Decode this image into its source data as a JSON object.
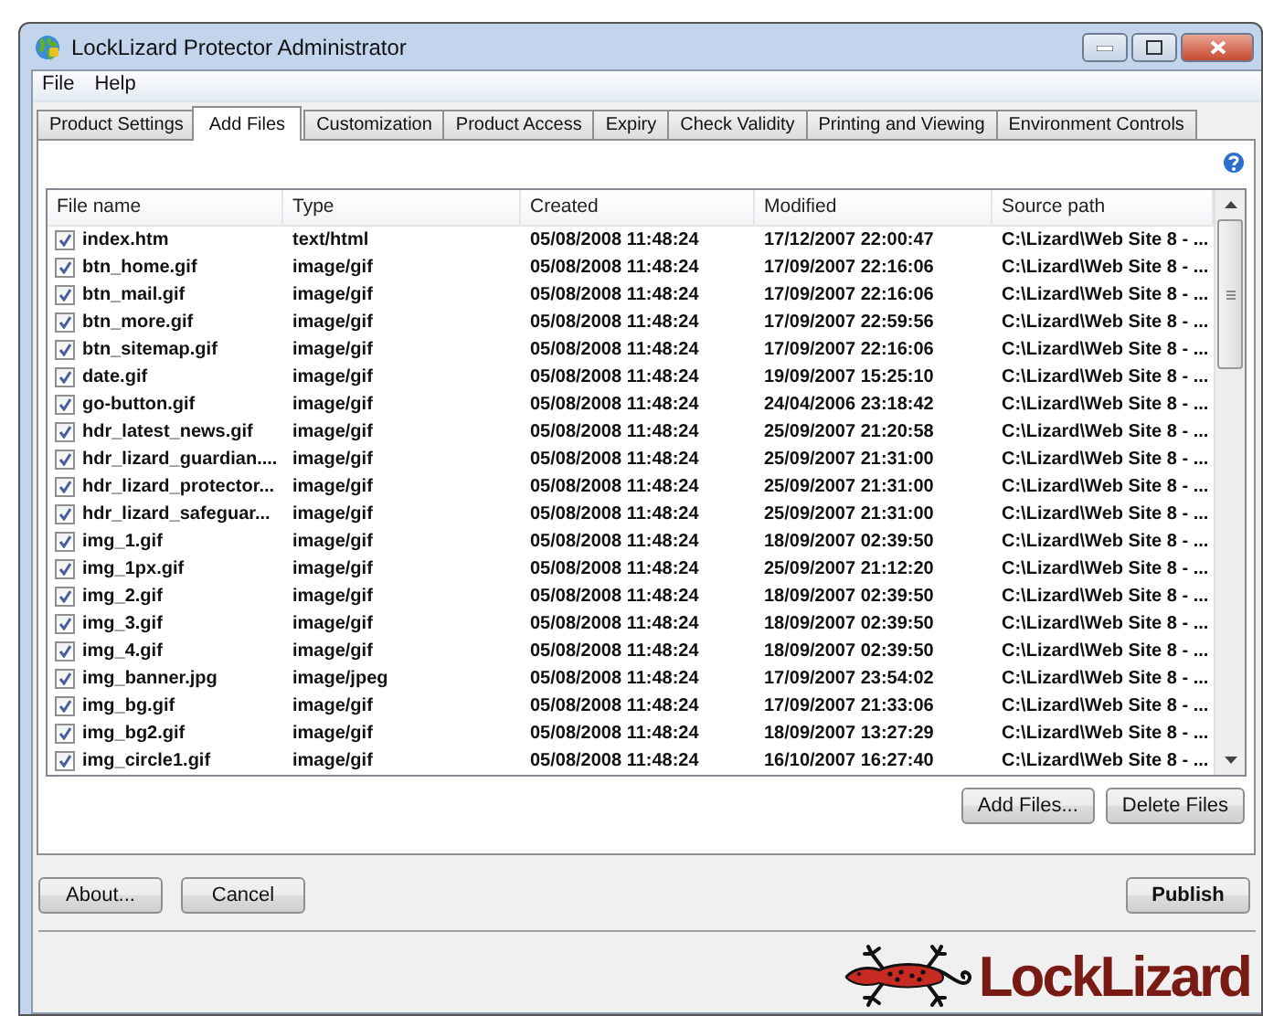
{
  "window": {
    "title": "LockLizard Protector Administrator"
  },
  "menu": [
    "File",
    "Help"
  ],
  "tabs": [
    {
      "label": "Product Settings",
      "selected": false
    },
    {
      "label": "Add Files",
      "selected": true
    },
    {
      "label": "Customization",
      "selected": false
    },
    {
      "label": "Product Access",
      "selected": false
    },
    {
      "label": "Expiry",
      "selected": false
    },
    {
      "label": "Check Validity",
      "selected": false
    },
    {
      "label": "Printing and Viewing",
      "selected": false
    },
    {
      "label": "Environment Controls",
      "selected": false
    }
  ],
  "table": {
    "columns": [
      "File name",
      "Type",
      "Created",
      "Modified",
      "Source path"
    ],
    "rows": [
      {
        "checked": true,
        "cells": [
          "index.htm",
          "text/html",
          "05/08/2008 11:48:24",
          "17/12/2007 22:00:47",
          "C:\\Lizard\\Web Site 8 - ..."
        ]
      },
      {
        "checked": true,
        "cells": [
          "btn_home.gif",
          "image/gif",
          "05/08/2008 11:48:24",
          "17/09/2007 22:16:06",
          "C:\\Lizard\\Web Site 8 - ..."
        ]
      },
      {
        "checked": true,
        "cells": [
          "btn_mail.gif",
          "image/gif",
          "05/08/2008 11:48:24",
          "17/09/2007 22:16:06",
          "C:\\Lizard\\Web Site 8 - ..."
        ]
      },
      {
        "checked": true,
        "cells": [
          "btn_more.gif",
          "image/gif",
          "05/08/2008 11:48:24",
          "17/09/2007 22:59:56",
          "C:\\Lizard\\Web Site 8 - ..."
        ]
      },
      {
        "checked": true,
        "cells": [
          "btn_sitemap.gif",
          "image/gif",
          "05/08/2008 11:48:24",
          "17/09/2007 22:16:06",
          "C:\\Lizard\\Web Site 8 - ..."
        ]
      },
      {
        "checked": true,
        "cells": [
          "date.gif",
          "image/gif",
          "05/08/2008 11:48:24",
          "19/09/2007 15:25:10",
          "C:\\Lizard\\Web Site 8 - ..."
        ]
      },
      {
        "checked": true,
        "cells": [
          "go-button.gif",
          "image/gif",
          "05/08/2008 11:48:24",
          "24/04/2006 23:18:42",
          "C:\\Lizard\\Web Site 8 - ..."
        ]
      },
      {
        "checked": true,
        "cells": [
          "hdr_latest_news.gif",
          "image/gif",
          "05/08/2008 11:48:24",
          "25/09/2007 21:20:58",
          "C:\\Lizard\\Web Site 8 - ..."
        ]
      },
      {
        "checked": true,
        "cells": [
          "hdr_lizard_guardian....",
          "image/gif",
          "05/08/2008 11:48:24",
          "25/09/2007 21:31:00",
          "C:\\Lizard\\Web Site 8 - ..."
        ]
      },
      {
        "checked": true,
        "cells": [
          "hdr_lizard_protector...",
          "image/gif",
          "05/08/2008 11:48:24",
          "25/09/2007 21:31:00",
          "C:\\Lizard\\Web Site 8 - ..."
        ]
      },
      {
        "checked": true,
        "cells": [
          "hdr_lizard_safeguar...",
          "image/gif",
          "05/08/2008 11:48:24",
          "25/09/2007 21:31:00",
          "C:\\Lizard\\Web Site 8 - ..."
        ]
      },
      {
        "checked": true,
        "cells": [
          "img_1.gif",
          "image/gif",
          "05/08/2008 11:48:24",
          "18/09/2007 02:39:50",
          "C:\\Lizard\\Web Site 8 - ..."
        ]
      },
      {
        "checked": true,
        "cells": [
          "img_1px.gif",
          "image/gif",
          "05/08/2008 11:48:24",
          "25/09/2007 21:12:20",
          "C:\\Lizard\\Web Site 8 - ..."
        ]
      },
      {
        "checked": true,
        "cells": [
          "img_2.gif",
          "image/gif",
          "05/08/2008 11:48:24",
          "18/09/2007 02:39:50",
          "C:\\Lizard\\Web Site 8 - ..."
        ]
      },
      {
        "checked": true,
        "cells": [
          "img_3.gif",
          "image/gif",
          "05/08/2008 11:48:24",
          "18/09/2007 02:39:50",
          "C:\\Lizard\\Web Site 8 - ..."
        ]
      },
      {
        "checked": true,
        "cells": [
          "img_4.gif",
          "image/gif",
          "05/08/2008 11:48:24",
          "18/09/2007 02:39:50",
          "C:\\Lizard\\Web Site 8 - ..."
        ]
      },
      {
        "checked": true,
        "cells": [
          "img_banner.jpg",
          "image/jpeg",
          "05/08/2008 11:48:24",
          "17/09/2007 23:54:02",
          "C:\\Lizard\\Web Site 8 - ..."
        ]
      },
      {
        "checked": true,
        "cells": [
          "img_bg.gif",
          "image/gif",
          "05/08/2008 11:48:24",
          "17/09/2007 21:33:06",
          "C:\\Lizard\\Web Site 8 - ..."
        ]
      },
      {
        "checked": true,
        "cells": [
          "img_bg2.gif",
          "image/gif",
          "05/08/2008 11:48:24",
          "18/09/2007 13:27:29",
          "C:\\Lizard\\Web Site 8 - ..."
        ]
      },
      {
        "checked": true,
        "cells": [
          "img_circle1.gif",
          "image/gif",
          "05/08/2008 11:48:24",
          "16/10/2007 16:27:40",
          "C:\\Lizard\\Web Site 8 - ..."
        ]
      }
    ]
  },
  "table_buttons": [
    "Add Files...",
    "Delete Files"
  ],
  "footer_buttons": [
    {
      "label": "About...",
      "kind": "normal"
    },
    {
      "label": "Cancel",
      "kind": "normal"
    },
    {
      "label": "Publish",
      "kind": "default"
    }
  ],
  "logo": {
    "text": "LockLizard"
  }
}
